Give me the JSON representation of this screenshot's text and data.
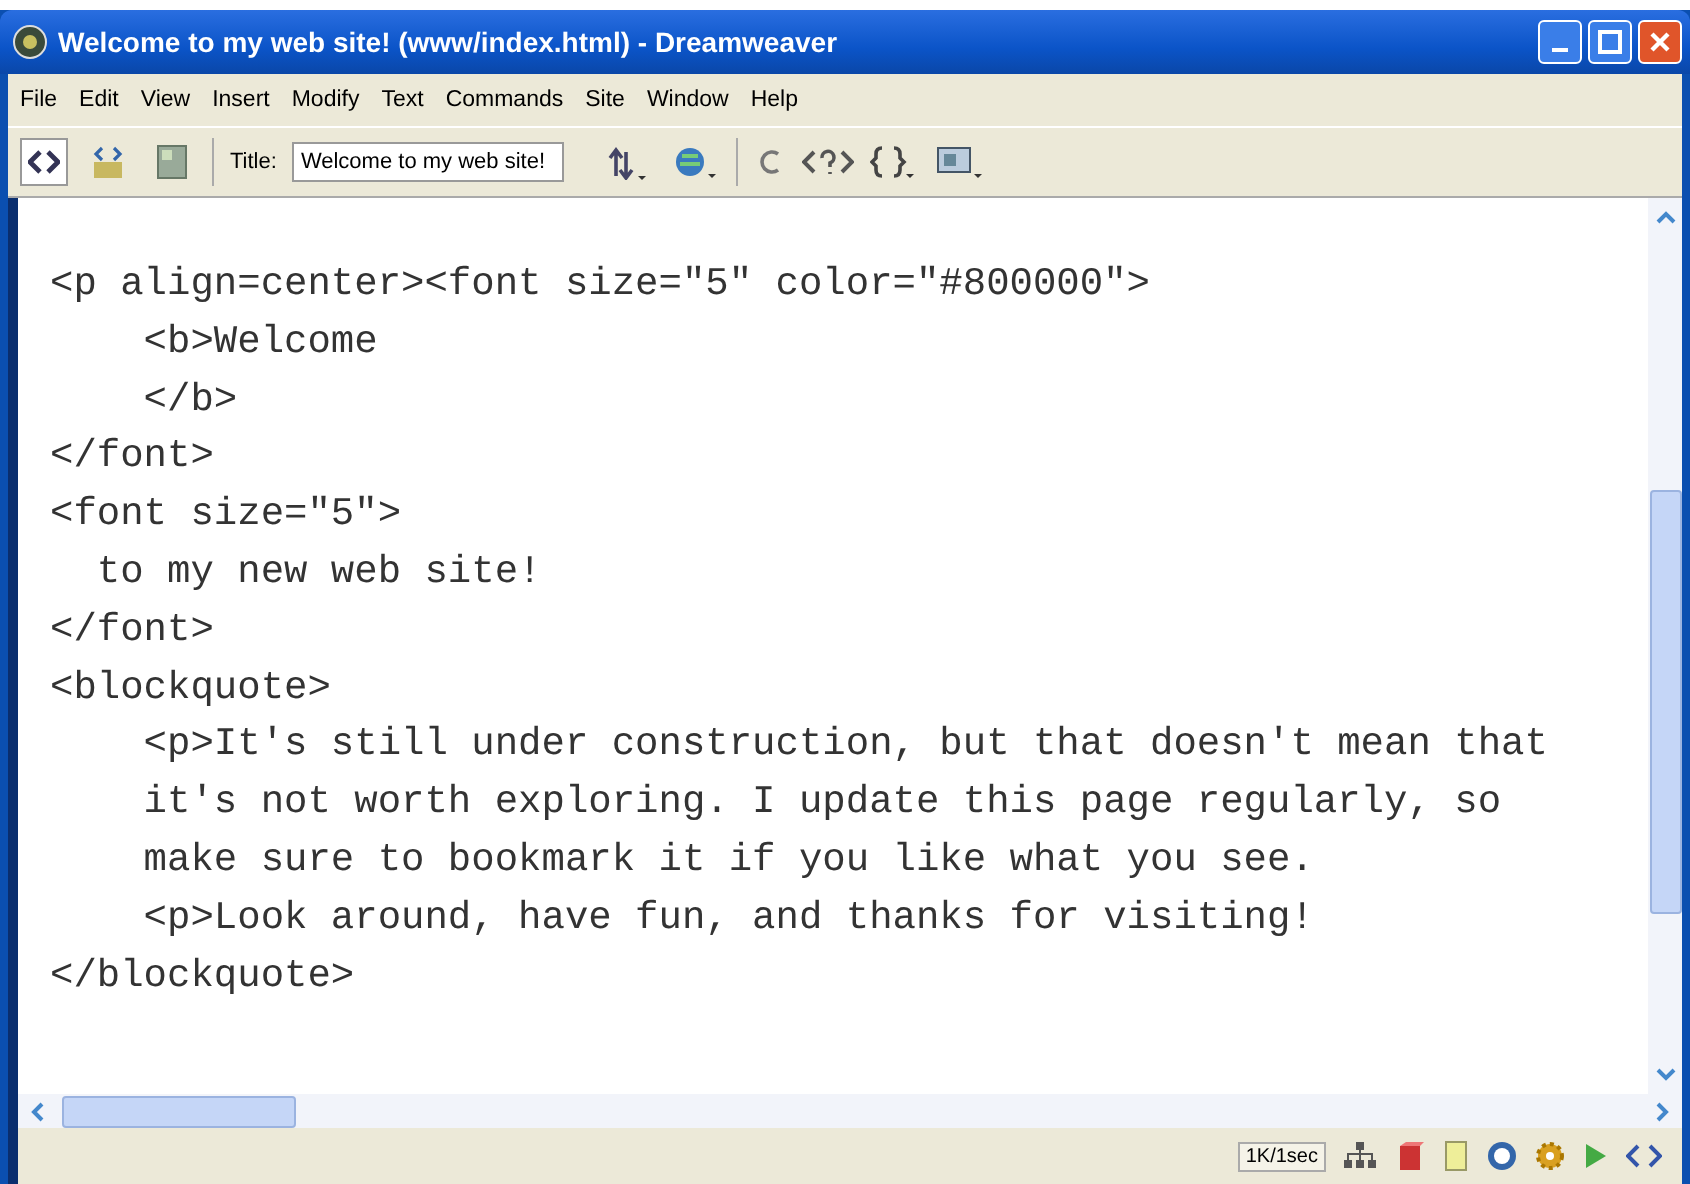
{
  "window": {
    "title": "Welcome to my web site! (www/index.html) - Dreamweaver"
  },
  "menu": [
    "File",
    "Edit",
    "View",
    "Insert",
    "Modify",
    "Text",
    "Commands",
    "Site",
    "Window",
    "Help"
  ],
  "toolbar": {
    "title_label": "Title:",
    "title_value": "Welcome to my web site!"
  },
  "code_lines": [
    "<p align=center><font size=\"5\" color=\"#800000\">",
    "    <b>Welcome",
    "    </b>",
    "</font>",
    "<font size=\"5\">",
    "  to my new web site!",
    "</font>",
    "<blockquote>",
    "    <p>It's still under construction, but that doesn't mean that",
    "    it's not worth exploring. I update this page regularly, so",
    "    make sure to bookmark it if you like what you see.",
    "    <p>Look around, have fun, and thanks for visiting!",
    "</blockquote>"
  ],
  "status_bar": {
    "download": "1K/1sec"
  }
}
